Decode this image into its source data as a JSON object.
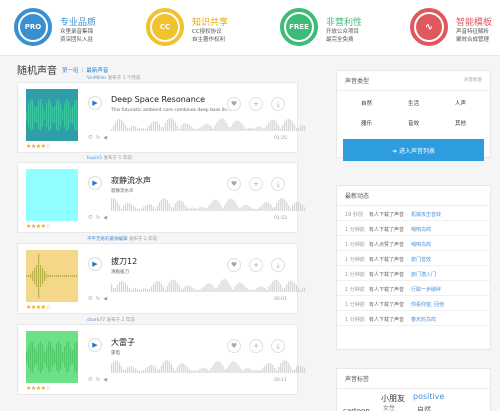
{
  "features": [
    {
      "icon_text": "PRO",
      "title": "专业品质",
      "desc1": "众里录音集锦",
      "desc2": "资深团队入驻",
      "color": "#3a8fd1"
    },
    {
      "icon_text": "CC",
      "title": "知识共享",
      "desc1": "CC授权协议",
      "desc2": "自主著作权利",
      "color": "#f2c12e"
    },
    {
      "icon_text": "FREE",
      "title": "非营利性",
      "desc1": "开放公众项目",
      "desc2": "最完全免费",
      "color": "#3dbb78"
    },
    {
      "icon_text": "∿",
      "title": "智能模板",
      "desc1": "声音特征解析",
      "desc2": "聚效合成管理",
      "color": "#e0585e"
    }
  ],
  "section": {
    "title": "随机声音",
    "crumb1": "第一组",
    "crumb2": "最新声音"
  },
  "cards": [
    {
      "user": "VinMiller",
      "posted": "发布于 1 个月前",
      "title": "Deep Space Resonance",
      "desc": "This futuristic ambient core combines deep bass lin...",
      "duration": "01:25",
      "stars": "★★★★☆",
      "thumb_bg": "#2f9ea6",
      "wave_color": "#3cc8a2"
    },
    {
      "user": "liupin5",
      "posted": "发布于 1 年前",
      "title": "寂静流水声",
      "desc": "寂静流水声",
      "duration": "01:22",
      "stars": "★★★★☆",
      "thumb_bg": "#8fffff",
      "wave_color": "#8fffff"
    },
    {
      "user": "平平无奇的最帅编辑",
      "posted": "发布于 2 年前",
      "title": "拔刀12",
      "desc": "清脆拔刀",
      "duration": "00:01",
      "stars": "★★★★☆",
      "thumb_bg": "#f5d78a",
      "wave_color": "#b9b34a"
    },
    {
      "user": "shark77",
      "posted": "发布于 2 年前",
      "title": "大雷子",
      "desc": "雷电",
      "duration": "00:11",
      "stars": "★★★★☆",
      "thumb_bg": "#6ee087",
      "wave_color": "#4fc96a"
    }
  ],
  "types_panel": {
    "title": "声音类型",
    "right": "声音标签",
    "items": [
      "自然",
      "生活",
      "人声",
      "器乐",
      "音效",
      "其他"
    ],
    "button": "➜ 进入声音列表"
  },
  "news_panel": {
    "title": "最新动态",
    "rows": [
      {
        "time": "19 秒前",
        "msg": "有人下载了声音",
        "name": "机械攻击音效"
      },
      {
        "time": "1 分钟前",
        "msg": "有人下载了声音",
        "name": "哨响鸟鸣"
      },
      {
        "time": "1 分钟前",
        "msg": "有人点赞了声音",
        "name": "哨响鸟鸣"
      },
      {
        "time": "1 分钟前",
        "msg": "有人下载了声音",
        "name": "旅门音效"
      },
      {
        "time": "1 分钟前",
        "msg": "有人下载了声音",
        "name": "旅门潜入门"
      },
      {
        "time": "1 分钟前",
        "msg": "有人下载了声音",
        "name": "行踪一步破碎"
      },
      {
        "time": "1 分钟前",
        "msg": "有人下载了声音",
        "name": "你看仰望, 回他"
      },
      {
        "time": "1 分钟前",
        "msg": "有人下载了声音",
        "name": "春天的鸟鸣"
      }
    ]
  },
  "tags_panel": {
    "title": "声音标签",
    "tags": [
      "小朋友",
      "positive",
      "女性",
      "cartoon",
      "自然"
    ]
  }
}
